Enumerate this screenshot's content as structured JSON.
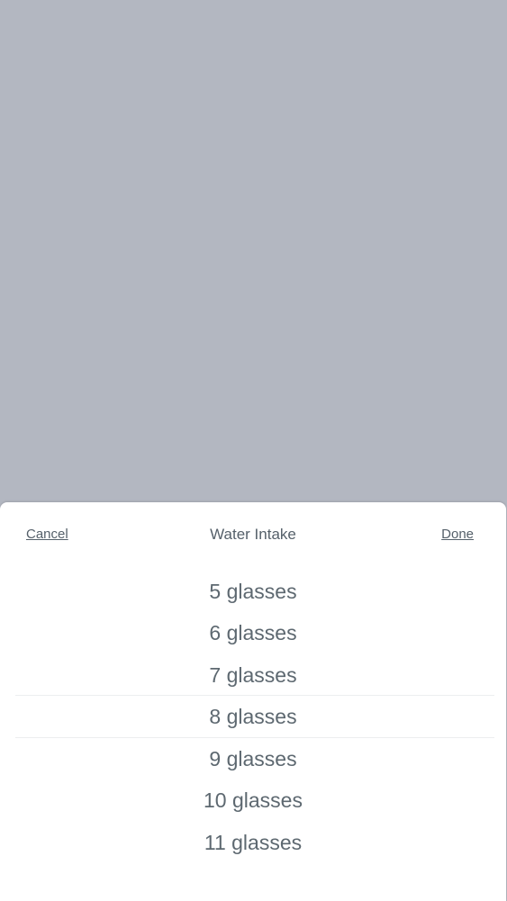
{
  "picker_sheet": {
    "title": "Water Intake",
    "cancel_label": "Cancel",
    "done_label": "Done",
    "options": [
      "5 glasses",
      "6 glasses",
      "7 glasses",
      "8 glasses",
      "9 glasses",
      "10 glasses",
      "11 glasses"
    ],
    "selected_option": "8 glasses"
  },
  "colors": {
    "backdrop": "#b3b7c1",
    "sheet_background": "#ffffff",
    "text": "#5d6870"
  }
}
